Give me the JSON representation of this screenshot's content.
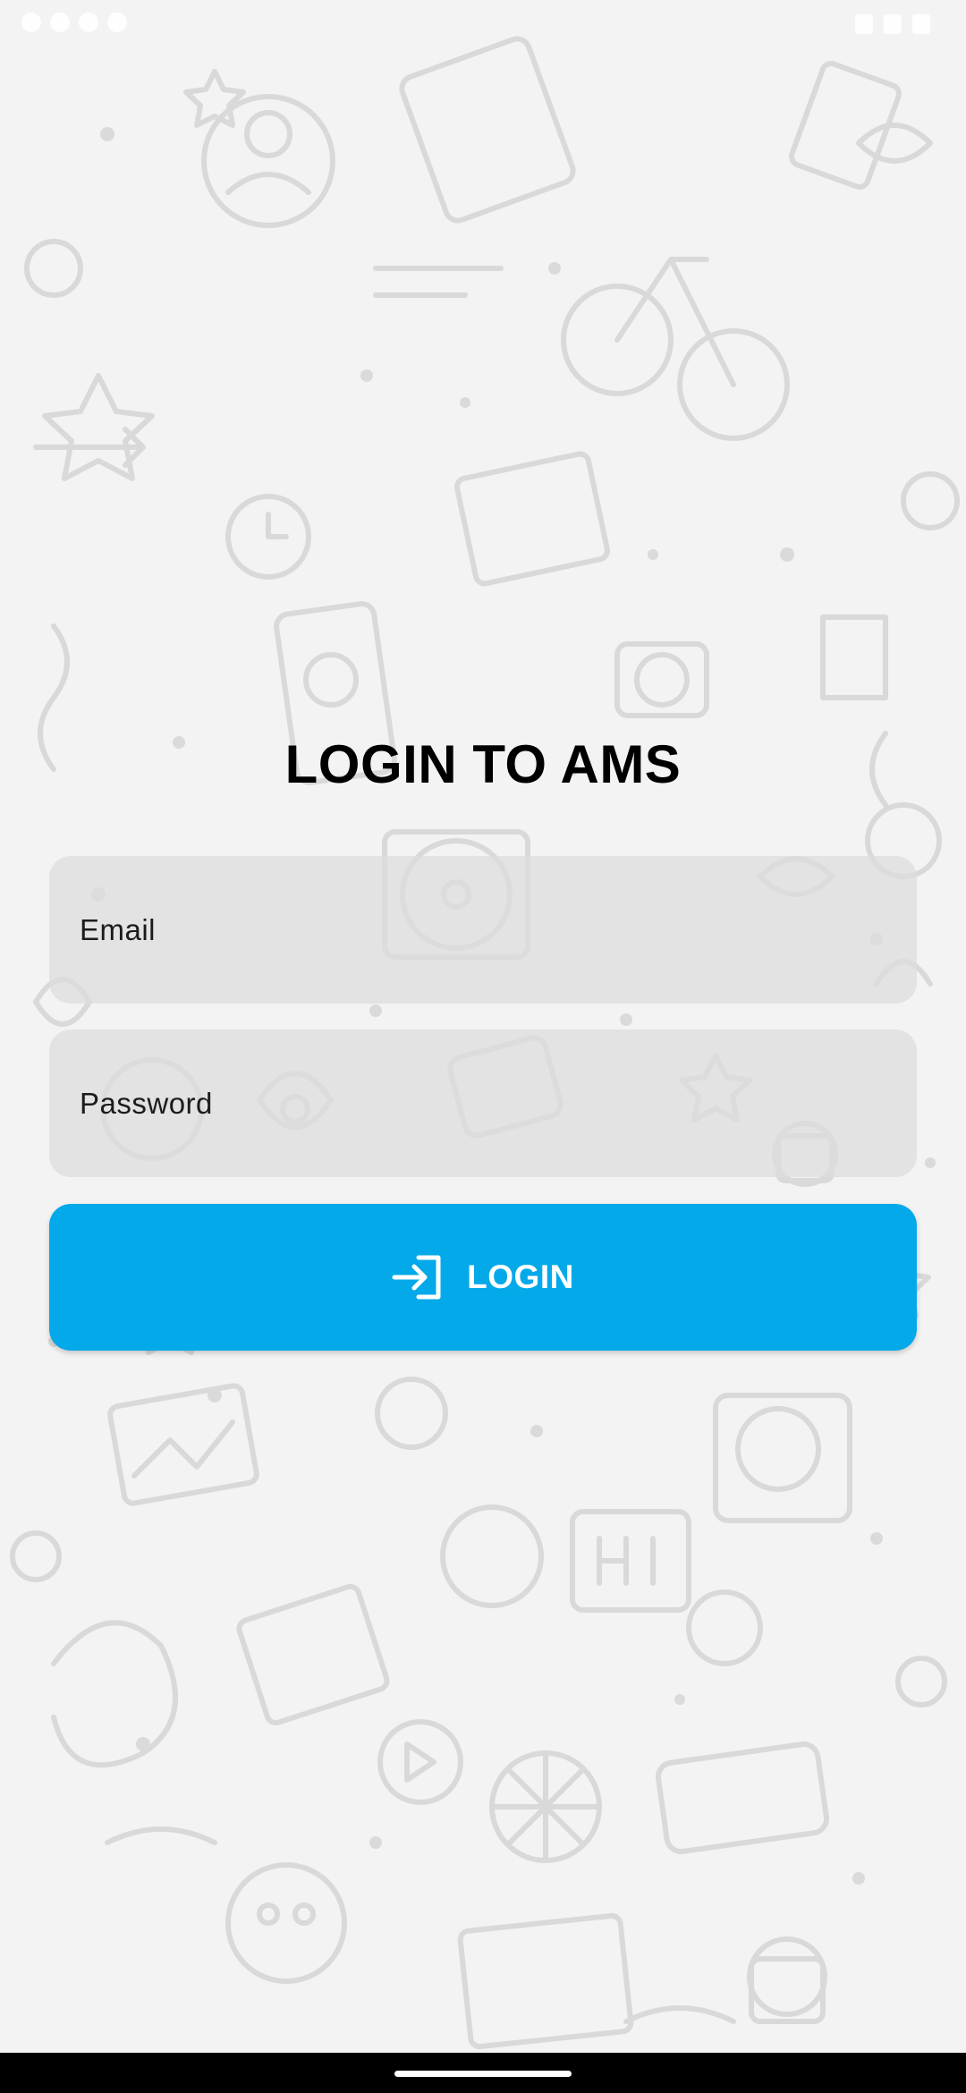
{
  "login": {
    "title": "LOGIN TO AMS",
    "email_placeholder": "Email",
    "password_placeholder": "Password",
    "button_label": "LOGIN",
    "button_icon": "login-icon"
  },
  "colors": {
    "accent": "#03a9e9",
    "field_bg": "#dcdcdc",
    "background": "#f3f3f3"
  }
}
